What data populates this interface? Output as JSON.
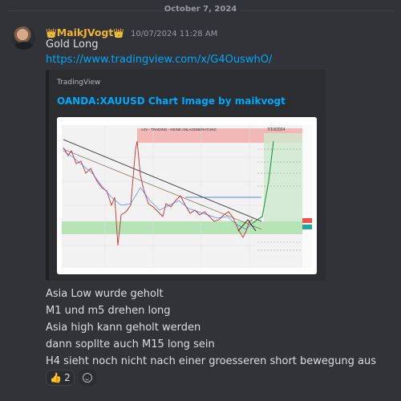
{
  "divider": {
    "date": "October 7, 2024"
  },
  "message": {
    "crown_left": "👑",
    "username": "MaikJVogt",
    "crown_right": "👑",
    "timestamp": "10/07/2024 11:28 AM",
    "lines_top": [
      "Gold Long"
    ],
    "link": "https://www.tradingview.com/x/G4OuswhO/",
    "lines_bottom": [
      "Asia Low wurde geholt",
      "M1 und m5 drehen long",
      "Asia high kann geholt werden",
      "dann sopllte auch M15 long sein",
      "H4 sieht noch nicht nach einer groesseren short bewegung aus"
    ]
  },
  "embed": {
    "provider": "TradingView",
    "title": "OANDA:XAUUSD Chart Image by maikvogt",
    "image_title": "AJV - TRADING - KEINE ANLAGEBERATUNG",
    "image_date": "7/10/2024"
  },
  "reactions": [
    {
      "emoji": "👍",
      "count": "2",
      "icon": "thumbs-up-icon"
    }
  ],
  "add_reaction_icon": "smile-icon",
  "colors": {
    "background": "#313338",
    "username": "#f0b232",
    "link": "#00a8fc",
    "embed_bg": "#2b2d31"
  }
}
